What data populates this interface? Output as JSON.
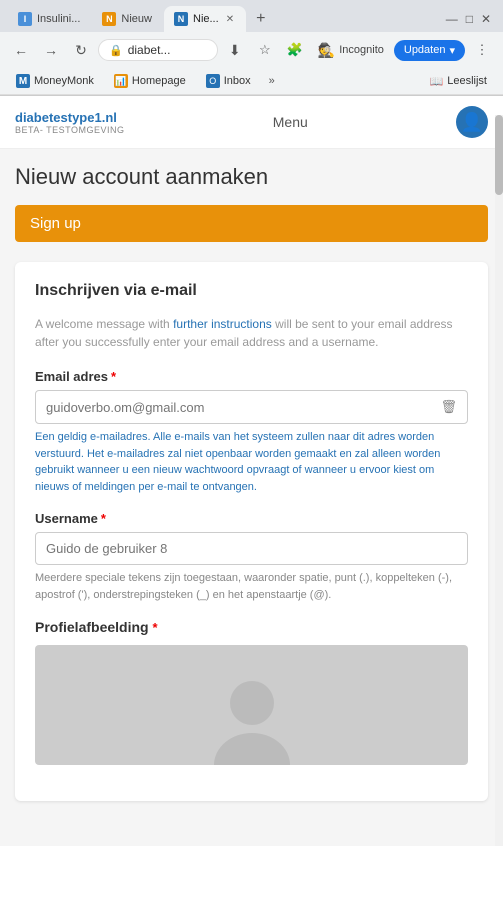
{
  "browser": {
    "tabs": [
      {
        "id": "tab-insulin",
        "label": "Insulini...",
        "favicon_color": "#4a90d9",
        "favicon_letter": "I",
        "active": false,
        "closeable": false
      },
      {
        "id": "tab-nieuw1",
        "label": "Nieuw",
        "favicon_color": "#e8910a",
        "favicon_letter": "N",
        "active": false,
        "closeable": false
      },
      {
        "id": "tab-nieuw2",
        "label": "Nie...",
        "favicon_color": "#2672b4",
        "favicon_letter": "N",
        "active": true,
        "closeable": true
      }
    ],
    "new_tab_icon": "+",
    "address": "diabet...",
    "lock_icon": "🔒",
    "back_disabled": false,
    "forward_disabled": false,
    "incognito_label": "Incognito",
    "update_btn_label": "Updaten",
    "bookmarks": [
      {
        "id": "bm-moneymonk",
        "label": "MoneyMonk",
        "type": "mm"
      },
      {
        "id": "bm-homepage",
        "label": "Homepage",
        "type": "hp"
      },
      {
        "id": "bm-inbox",
        "label": "Inbox",
        "type": "ol"
      }
    ],
    "reading_mode_label": "Leeslijst"
  },
  "site": {
    "logo_main": "diabetestype1.nl",
    "logo_sub": "BETA- TESTOMGEVING",
    "menu_label": "Menu",
    "user_icon": "👤"
  },
  "page": {
    "title": "Nieuw account aanmaken",
    "signup_btn_label": "Sign up",
    "card_title": "Inschrijven via e-mail",
    "welcome_text": "A welcome message with further instructions will be sent to your email address after you successfully enter your email address and a username.",
    "email_label": "Email adres",
    "email_required": "*",
    "email_placeholder": "guidoverbo.om@gmail.com",
    "email_hint": "Een geldig e-mailadres. Alle e-mails van het systeem zullen naar dit adres worden verstuurd. Het e-mailadres zal niet openbaar worden gemaakt en zal alleen worden gebruikt wanneer u een nieuw wachtwoord opvraagt of wanneer u ervoor kiest om nieuws of meldingen per e-mail te ontvangen.",
    "username_label": "Username",
    "username_required": "*",
    "username_placeholder": "Guido de gebruiker 8",
    "username_hint": "Meerdere speciale tekens zijn toegestaan, waaronder spatie, punt (.), koppelteken (-), apostrof ('), onderstrepingsteken (_) en het apenstaartje (@).",
    "profile_label": "Profielafbeelding",
    "profile_required": "*"
  }
}
